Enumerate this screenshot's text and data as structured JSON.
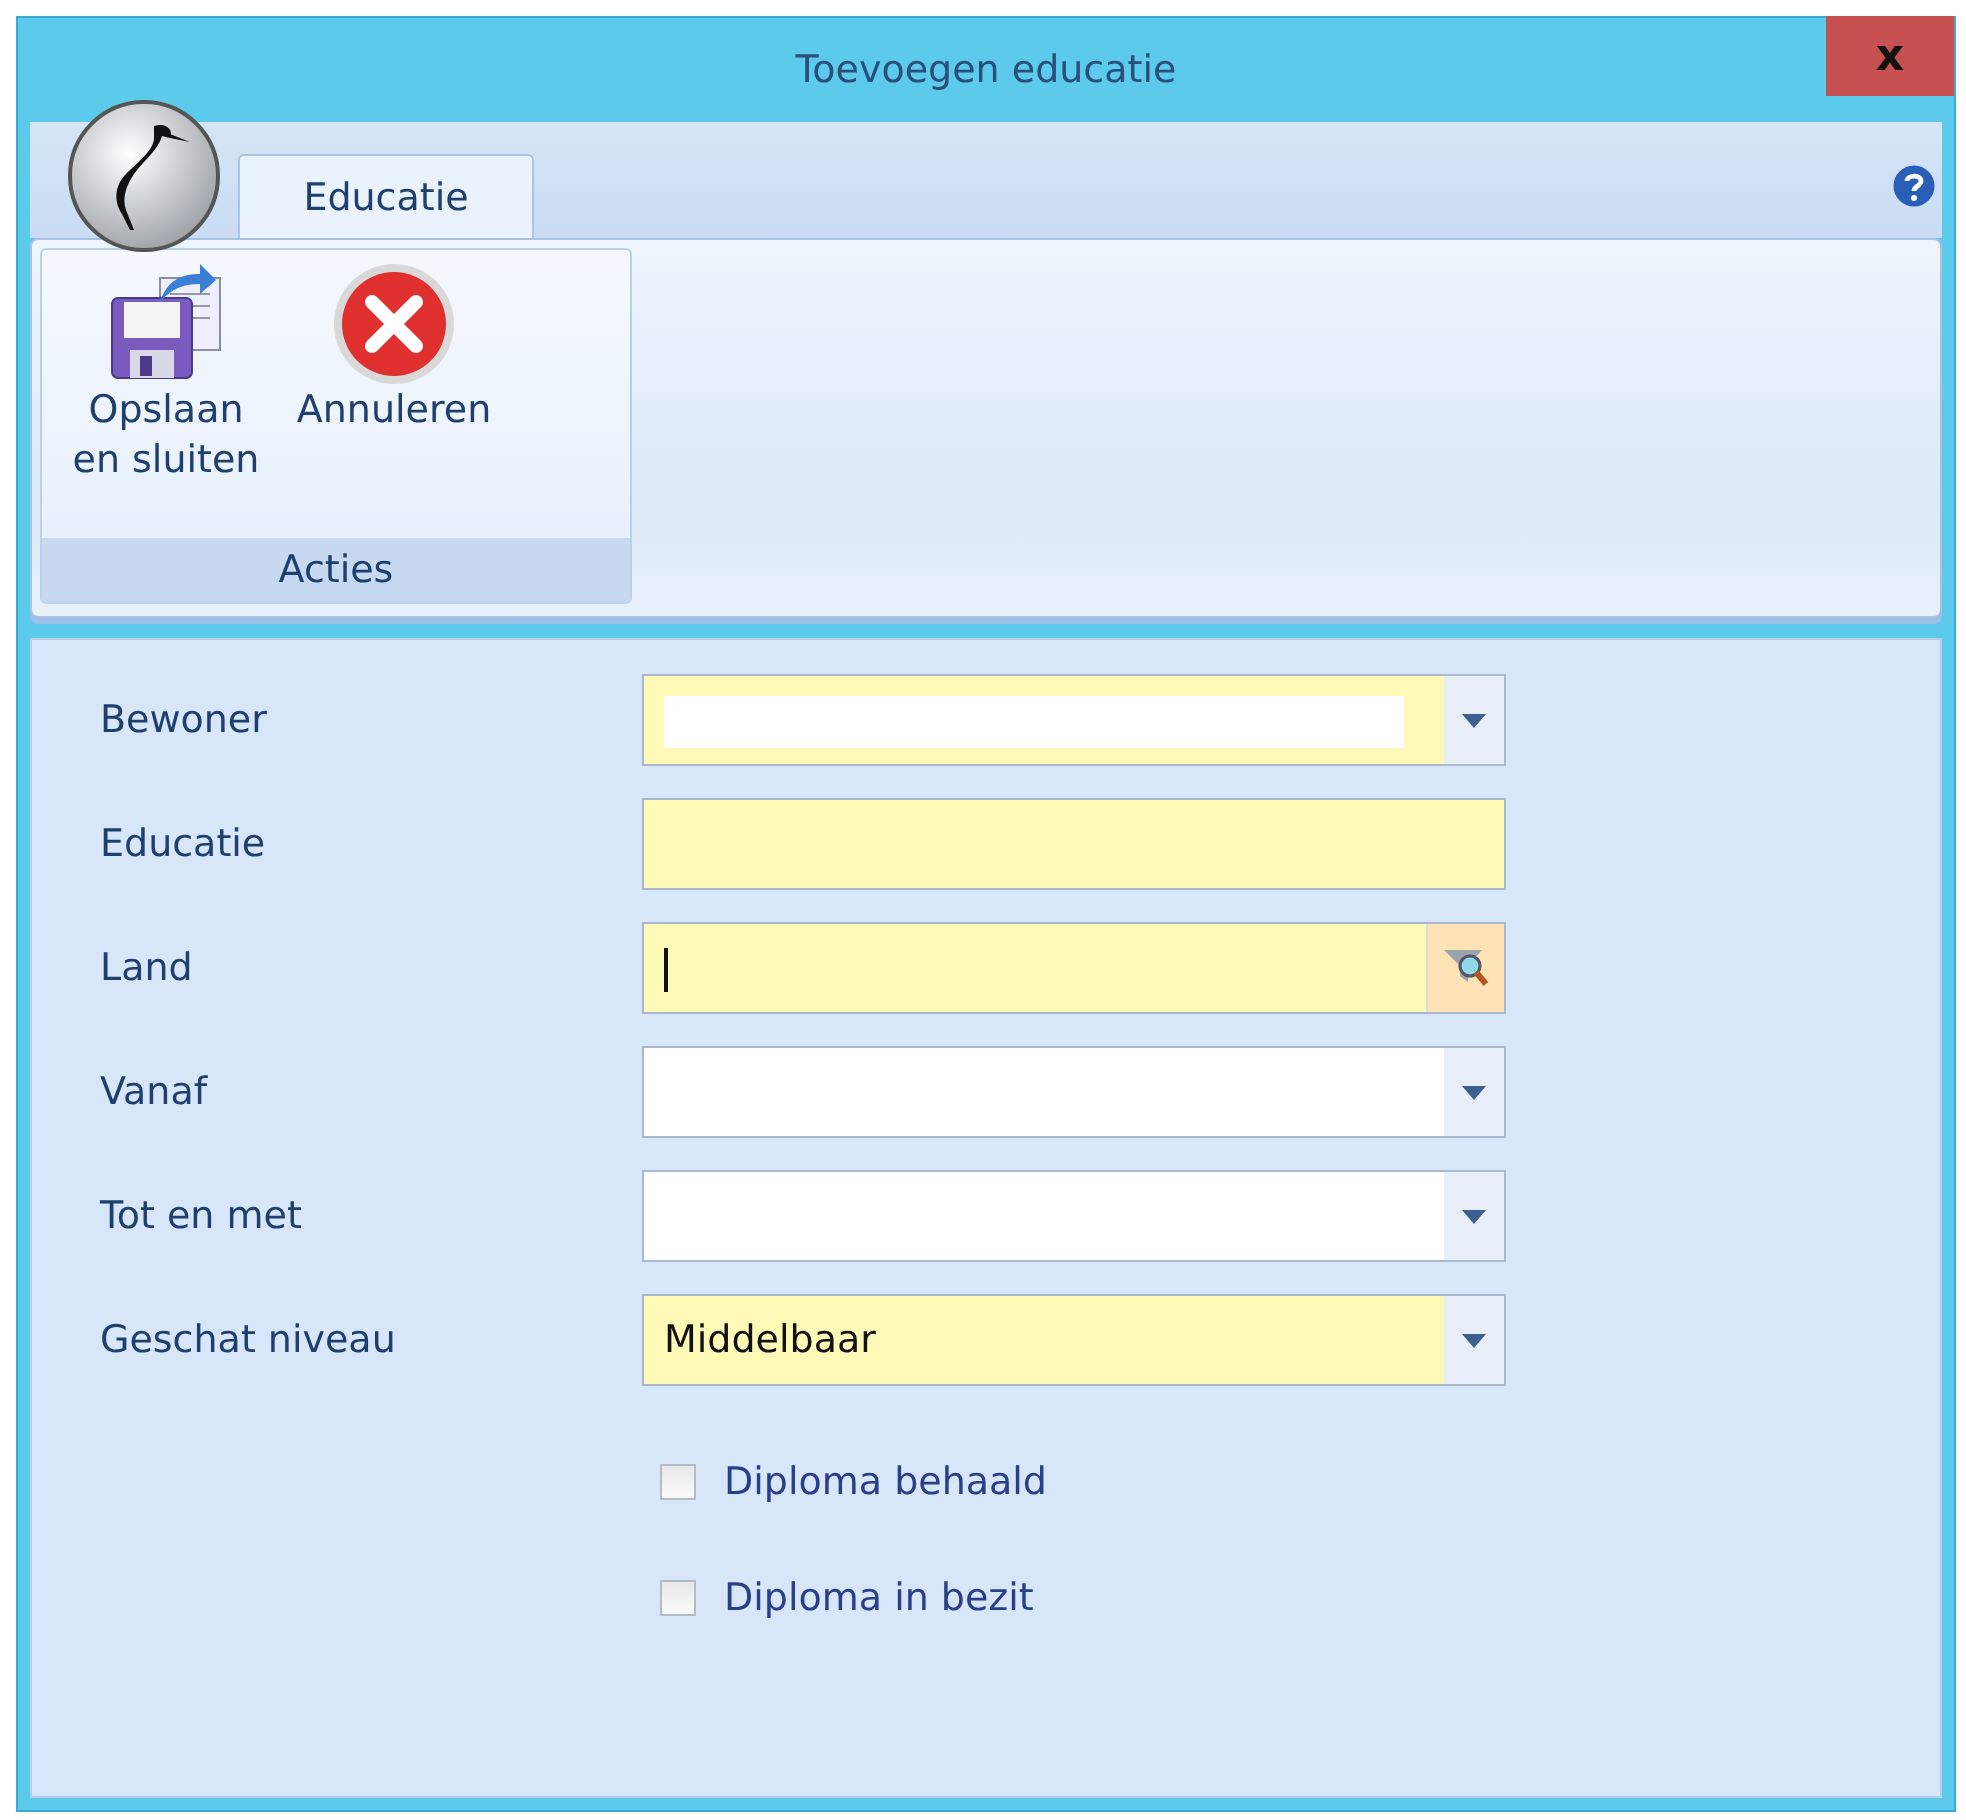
{
  "window": {
    "title": "Toevoegen educatie",
    "close": "x"
  },
  "tabs": [
    {
      "label": "Educatie",
      "selected": true
    }
  ],
  "ribbon": {
    "groups": [
      {
        "label": "Acties",
        "buttons": [
          {
            "kind": "save",
            "label": "Opslaan en sluiten"
          },
          {
            "kind": "cancel",
            "label": "Annuleren"
          }
        ]
      }
    ]
  },
  "fields": [
    {
      "label": "Bewoner",
      "kind": "combo",
      "required": true,
      "masked": true,
      "focused": false
    },
    {
      "label": "Educatie",
      "kind": "text",
      "required": true,
      "focused": false
    },
    {
      "label": "Land",
      "kind": "lookup",
      "required": true,
      "focused": true
    },
    {
      "label": "Vanaf",
      "kind": "combo",
      "required": false,
      "focused": false
    },
    {
      "label": "Tot en met",
      "kind": "combo",
      "required": false,
      "focused": false
    },
    {
      "label": "Geschat niveau",
      "kind": "combo",
      "required": true,
      "value": "Middelbaar",
      "focused": false
    }
  ],
  "checkboxes": [
    {
      "label": "Diploma behaald",
      "checked": false
    },
    {
      "label": "Diploma in bezit",
      "checked": false
    }
  ]
}
